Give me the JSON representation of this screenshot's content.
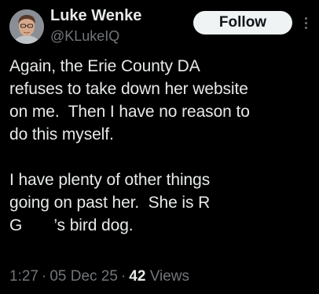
{
  "author": {
    "display_name": "Luke Wenke",
    "handle": "@KLukeIQ",
    "avatar_icon": "user-avatar"
  },
  "actions": {
    "follow_label": "Follow",
    "more_icon": "more-vertical-icon"
  },
  "tweet": {
    "paragraph_1_lines": [
      "Again, the Erie County DA",
      "refuses to take down her website",
      "on me.  Then I have no reason to",
      "do this myself."
    ],
    "paragraph_2_lines": [
      "I have plenty of other things",
      "going on past her.  She is R",
      "G       ’s bird dog."
    ]
  },
  "meta": {
    "time": "1:27",
    "separator": "·",
    "date": "05 Dec 25",
    "views_count": "42",
    "views_label": "Views"
  },
  "colors": {
    "background": "#000000",
    "primary_text": "#e7e9ea",
    "secondary_text": "#71767b",
    "follow_bg": "#eff3f4"
  }
}
